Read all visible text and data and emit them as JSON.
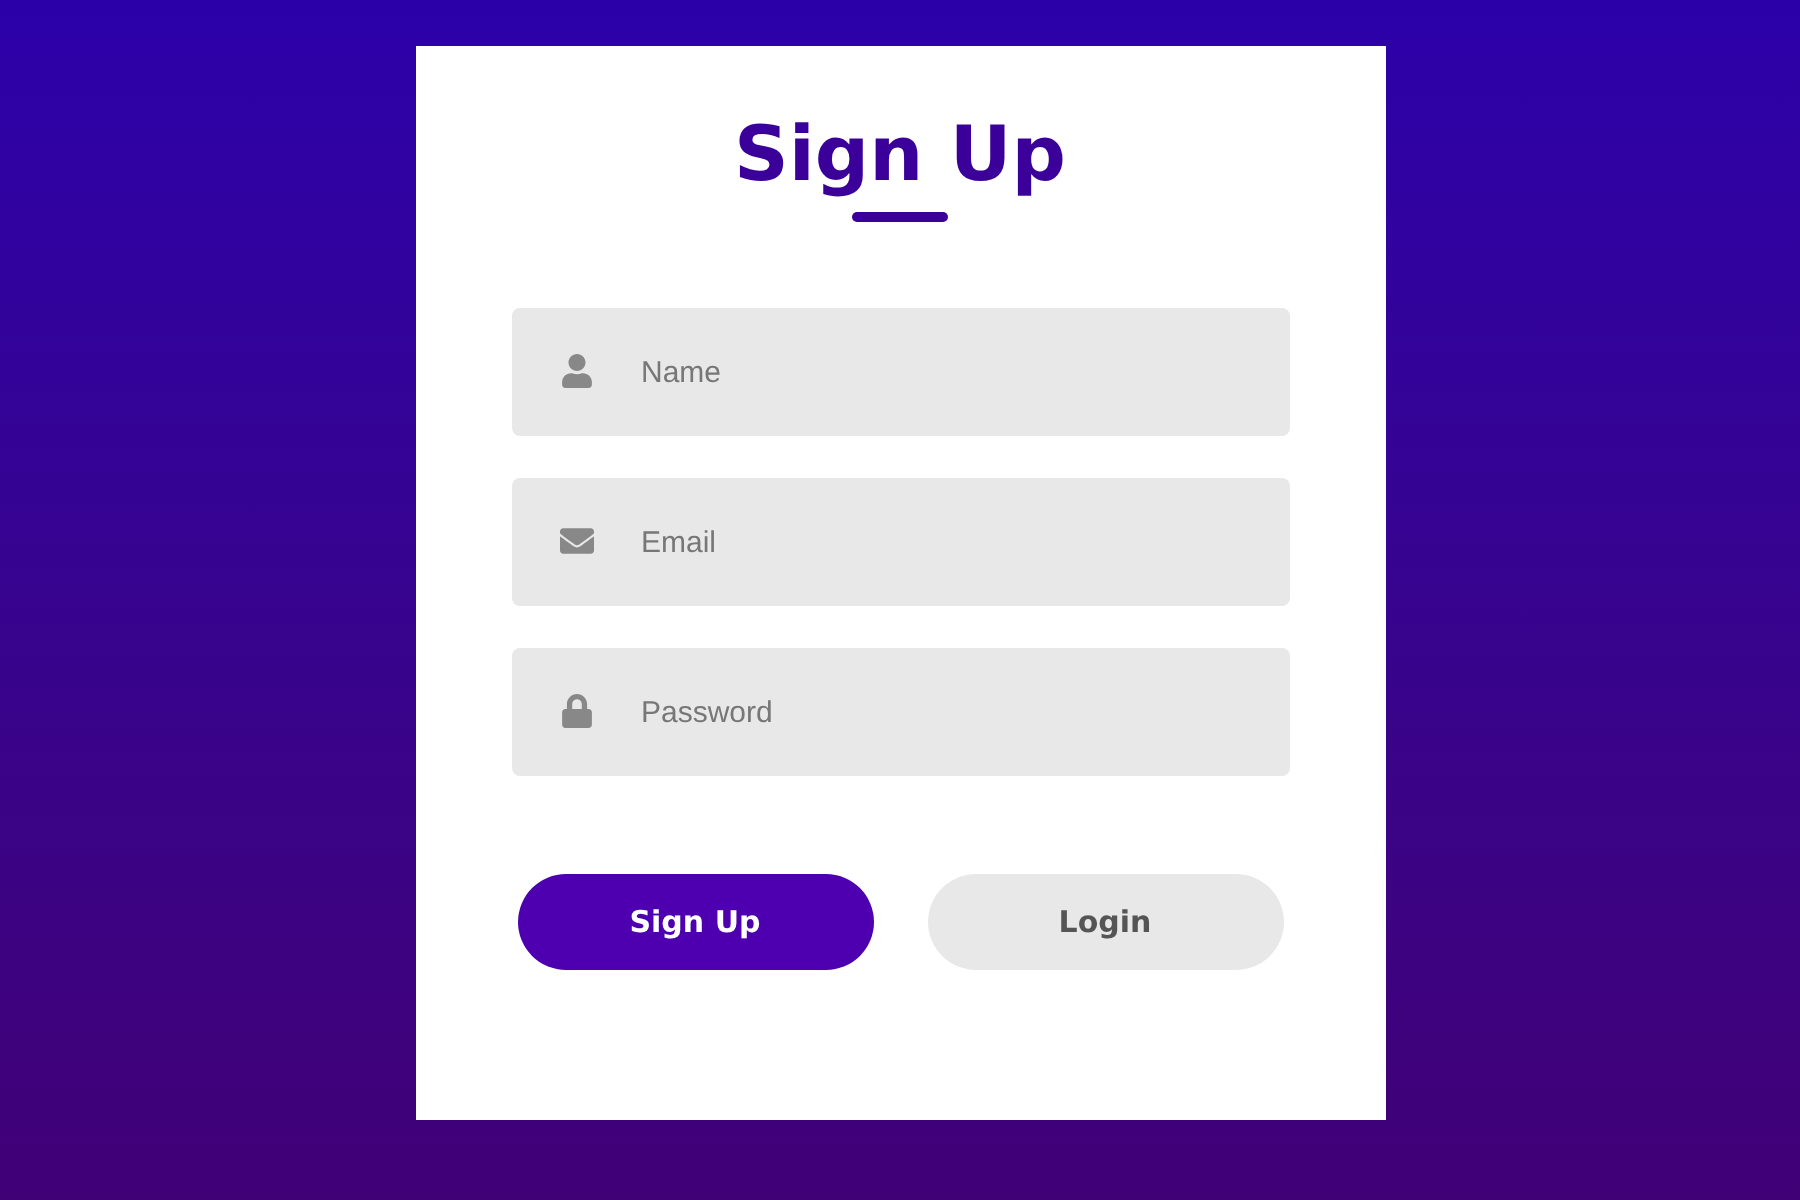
{
  "title": "Sign Up",
  "fields": [
    {
      "kind": "name",
      "placeholder": "Name"
    },
    {
      "kind": "email",
      "placeholder": "Email"
    },
    {
      "kind": "password",
      "placeholder": "Password"
    }
  ],
  "buttons": [
    {
      "label": "Sign Up",
      "kind": "primary"
    },
    {
      "label": "Login",
      "kind": "secondary"
    }
  ]
}
